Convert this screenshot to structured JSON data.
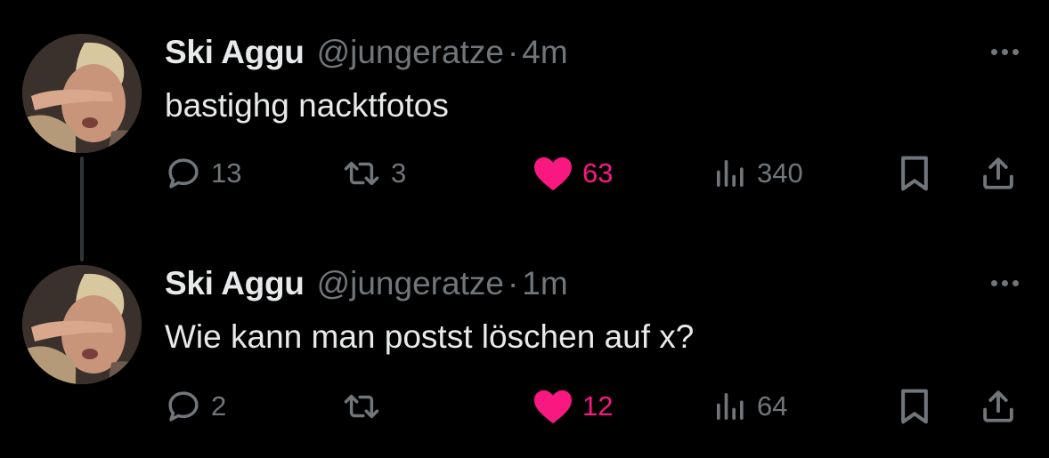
{
  "tweets": [
    {
      "author": {
        "name": "Ski Aggu",
        "handle": "@jungeratze"
      },
      "separator": "·",
      "time": "4m",
      "text": "bastighg nacktfotos",
      "stats": {
        "replies": "13",
        "retweets": "3",
        "likes": "63",
        "views": "340"
      },
      "liked": true
    },
    {
      "author": {
        "name": "Ski Aggu",
        "handle": "@jungeratze"
      },
      "separator": "·",
      "time": "1m",
      "text": "Wie kann man postst löschen auf x?",
      "stats": {
        "replies": "2",
        "retweets": "",
        "likes": "12",
        "views": "64"
      },
      "liked": true
    }
  ],
  "colors": {
    "background": "#000000",
    "text": "#e7e9ea",
    "muted": "#71767b",
    "like": "#f91880",
    "thread_line": "#333639"
  },
  "icons": [
    "avatar-photo",
    "more-icon",
    "reply-icon",
    "retweet-icon",
    "heart-icon",
    "views-icon",
    "bookmark-icon",
    "share-icon"
  ]
}
